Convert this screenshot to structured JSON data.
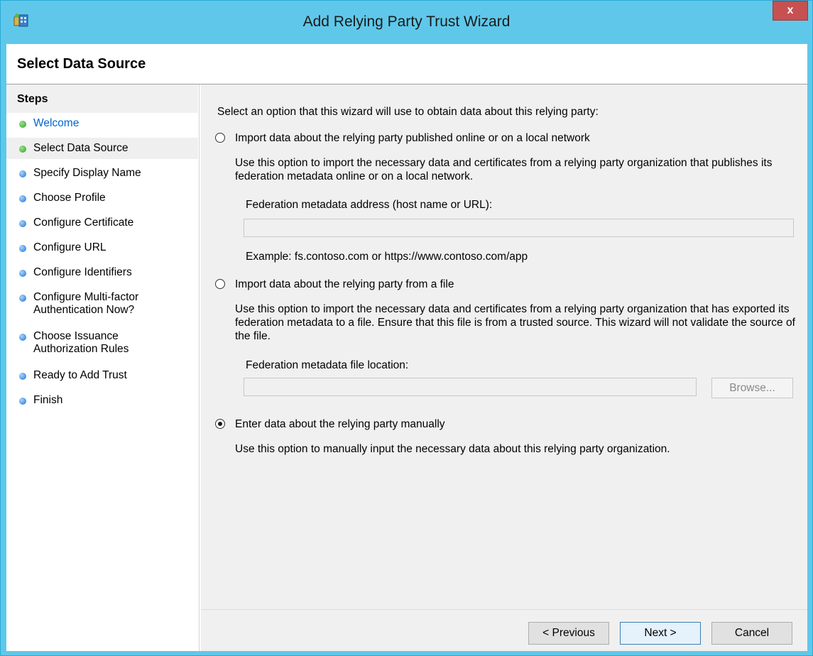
{
  "window": {
    "title": "Add Relying Party Trust Wizard",
    "close_label": "x"
  },
  "header": {
    "title": "Select Data Source"
  },
  "steps": {
    "title": "Steps",
    "items": [
      {
        "label": "Welcome",
        "status": "done",
        "is_link": true
      },
      {
        "label": "Select Data Source",
        "status": "current"
      },
      {
        "label": "Specify Display Name",
        "status": "pending"
      },
      {
        "label": "Choose Profile",
        "status": "pending"
      },
      {
        "label": "Configure Certificate",
        "status": "pending"
      },
      {
        "label": "Configure URL",
        "status": "pending"
      },
      {
        "label": "Configure Identifiers",
        "status": "pending"
      },
      {
        "label": "Configure Multi-factor\nAuthentication Now?",
        "status": "pending"
      },
      {
        "label": "Choose Issuance\nAuthorization Rules",
        "status": "pending"
      },
      {
        "label": "Ready to Add Trust",
        "status": "pending"
      },
      {
        "label": "Finish",
        "status": "pending"
      }
    ]
  },
  "main": {
    "intro": "Select an option that this wizard will use to obtain data about this relying party:",
    "option1": {
      "label": "Import data about the relying party published online or on a local network",
      "description": "Use this option to import the necessary data and certificates from a relying party organization that publishes its federation metadata online or on a local network.",
      "field_label": "Federation metadata address (host name or URL):",
      "field_value": "",
      "example": "Example: fs.contoso.com or https://www.contoso.com/app",
      "checked": false
    },
    "option2": {
      "label": "Import data about the relying party from a file",
      "description": "Use this option to import the necessary data and certificates from a relying party organization that has exported its federation metadata to a file. Ensure that this file is from a trusted source.  This wizard will not validate the source of the file.",
      "field_label": "Federation metadata file location:",
      "field_value": "",
      "browse_label": "Browse...",
      "checked": false
    },
    "option3": {
      "label": "Enter data about the relying party manually",
      "description": "Use this option to manually input the necessary data about this relying party organization.",
      "checked": true
    }
  },
  "footer": {
    "previous_label": "< Previous",
    "next_label": "Next >",
    "cancel_label": "Cancel"
  },
  "colors": {
    "titlebar": "#5fc8ea",
    "close": "#c75050",
    "link": "#0066cc",
    "step_done": "#2e9d2e",
    "step_pending": "#1f6fd0"
  }
}
